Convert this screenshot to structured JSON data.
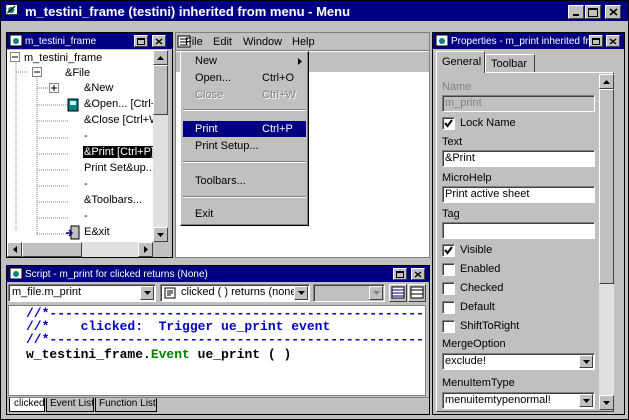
{
  "main_title": "m_testini_frame (testini) inherited from menu - Menu",
  "tree_window": {
    "title": "m_testini_frame",
    "items": [
      "m_testini_frame",
      "&File",
      "&New",
      "&Open...  [Ctrl+",
      "&Close  [Ctrl+W",
      "-",
      "&Print  [Ctrl+P]",
      "Print Set&up...",
      "-",
      "&Toolbars...",
      "-",
      "E&xit"
    ]
  },
  "preview_menubar": [
    "File",
    "Edit",
    "Window",
    "Help"
  ],
  "dropdown_menu": {
    "items": [
      {
        "label": "New",
        "shortcut": ""
      },
      {
        "label": "Open...",
        "shortcut": "Ctrl+O"
      },
      {
        "label": "Close",
        "shortcut": "Ctrl+W"
      },
      {
        "label": "Print",
        "shortcut": "Ctrl+P"
      },
      {
        "label": "Print Setup...",
        "shortcut": ""
      },
      {
        "label": "Toolbars...",
        "shortcut": ""
      },
      {
        "label": "Exit",
        "shortcut": ""
      }
    ]
  },
  "properties": {
    "title": "Properties - m_print  inherited fr",
    "tabs": [
      "General",
      "Toolbar"
    ],
    "name_label": "Name",
    "name_value": "m_print",
    "lock_name_label": "Lock Name",
    "lock_name_checked": true,
    "text_label": "Text",
    "text_value": "&Print",
    "microhelp_label": "MicroHelp",
    "microhelp_value": "Print active sheet",
    "tag_label": "Tag",
    "tag_value": "",
    "visible_label": "Visible",
    "visible_checked": true,
    "enabled_label": "Enabled",
    "checked_label": "Checked",
    "default_label": "Default",
    "shifttoright_label": "ShiftToRight",
    "mergeoption_label": "MergeOption",
    "mergeoption_value": "exclude!",
    "menuitemtype_label": "MenuItemType",
    "menuitemtype_value": "menuitemtypenormal!"
  },
  "script_window": {
    "title": "Script - m_print for clicked returns (None)",
    "object_select": "m_file.m_print",
    "event_select": "clicked ( ) returns (none",
    "third_select": "",
    "code_lines": [
      "//*----------------------------------------------------------",
      "//*    clicked:  Trigger ue_print event",
      "//*----------------------------------------------------------",
      "w_testini_frame.Event ue_print ( )"
    ],
    "code_line4_parts": {
      "a": "w_testini_frame.",
      "b": "Event",
      "c": " ue_print ( )"
    },
    "tabs": [
      "clicked",
      "Event List",
      "Function List"
    ]
  },
  "colors": {
    "title_active": "#000080",
    "comment_blue": "#0000c0",
    "keyword_green": "#008000",
    "selection": "#000000"
  }
}
